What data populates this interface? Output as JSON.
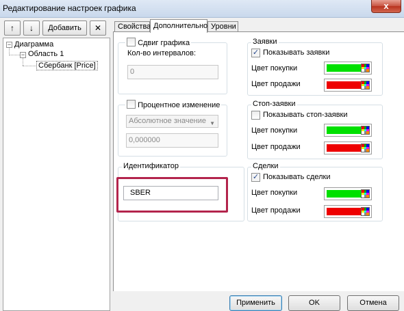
{
  "window": {
    "title": "Редактирование настроек графика",
    "close_label": "x"
  },
  "toolbar": {
    "up_label": "↑",
    "down_label": "↓",
    "add_label": "Добавить",
    "delete_label": "✕"
  },
  "tree": {
    "root": {
      "label": "Диаграмма",
      "toggle": "−"
    },
    "area": {
      "label": "Область 1",
      "toggle": "−"
    },
    "leaf": {
      "label": "Сбербанк [Price]"
    }
  },
  "tabs": [
    {
      "label": "Свойства"
    },
    {
      "label": "Дополнительно"
    },
    {
      "label": "Уровни"
    }
  ],
  "shift": {
    "checkbox_label": "Сдвиг графика",
    "checked": false,
    "intervals_label": "Кол-во интервалов:",
    "intervals_value": "0"
  },
  "percent": {
    "checkbox_label": "Процентное изменение",
    "checked": false,
    "mode_value": "Абсолютное значение",
    "value": "0,000000"
  },
  "identifier": {
    "title": "Идентификатор",
    "value": "SBER"
  },
  "orders": {
    "title": "Заявки",
    "show_label": "Показывать заявки",
    "checked": true,
    "buy_label": "Цвет покупки",
    "sell_label": "Цвет продажи"
  },
  "stop_orders": {
    "title": "Стоп-заявки",
    "show_label": "Показывать стоп-заявки",
    "checked": false,
    "buy_label": "Цвет покупки",
    "sell_label": "Цвет продажи"
  },
  "deals": {
    "title": "Сделки",
    "show_label": "Показывать сделки",
    "checked": true,
    "buy_label": "Цвет покупки",
    "sell_label": "Цвет продажи"
  },
  "colors": {
    "buy": "#00e000",
    "sell": "#ee0000",
    "highlight": "#b3244c"
  },
  "check_mark": "✓",
  "footer": {
    "apply_label": "Применить",
    "ok_label": "OK",
    "cancel_label": "Отмена"
  }
}
